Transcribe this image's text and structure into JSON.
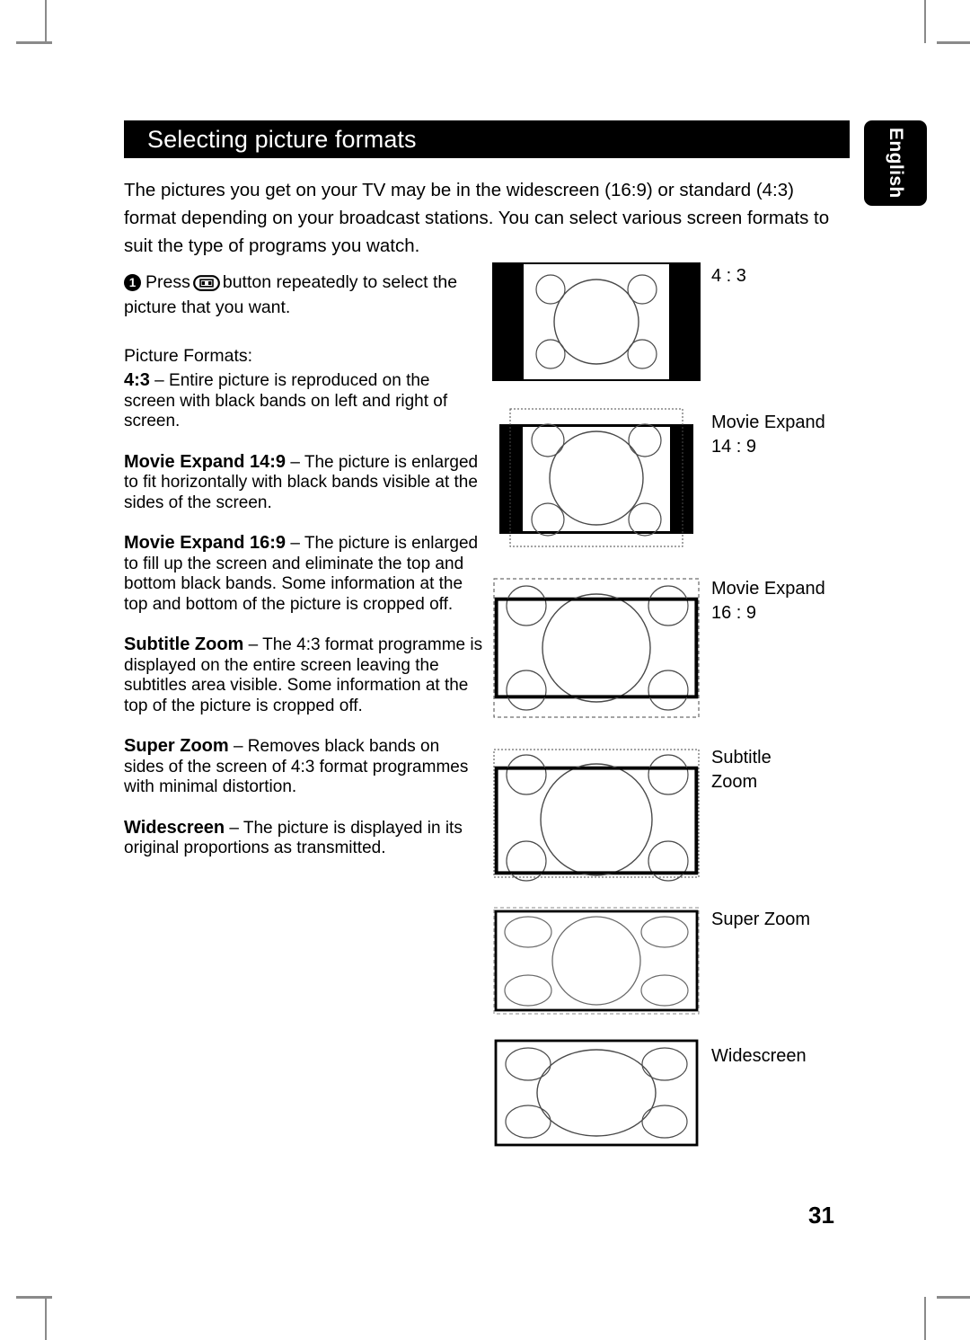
{
  "document": {
    "page_number": "31",
    "language_tab": "English",
    "title": "Selecting picture formats",
    "intro": "The pictures you get on your TV may be in the widescreen (16:9) or standard (4:3) format depending on your broadcast stations. You can select various screen formats to suit the type of programs you watch."
  },
  "step": {
    "number": "1",
    "text_before_icon": "Press",
    "icon_name": "picture-format-button-icon",
    "text_after_icon": "button repeatedly to select the picture that you want."
  },
  "formats_heading": "Picture Formats:",
  "formats": [
    {
      "name": "4:3",
      "dash": " – ",
      "description": "Entire picture is reproduced on the screen with black bands on left and right of screen.",
      "diagram_label": "4 : 3"
    },
    {
      "name": "Movie Expand 14:9",
      "dash": " – ",
      "description": "The picture is enlarged to fit horizontally with black bands visible at the sides of the screen.",
      "diagram_label": "Movie Expand\n14 : 9"
    },
    {
      "name": "Movie Expand 16:9",
      "dash": " – ",
      "description": "The picture is enlarged to fill up the screen and eliminate the top and bottom black bands.  Some information at the top and bottom of the picture is cropped off.",
      "diagram_label": "Movie Expand\n16 : 9"
    },
    {
      "name": "Subtitle Zoom",
      "dash": " – ",
      "description": "The 4:3 format programme is displayed on the entire screen leaving the subtitles area visible.  Some information at the top of the picture is cropped off.",
      "diagram_label": "Subtitle\nZoom"
    },
    {
      "name": "Super Zoom",
      "dash": " – ",
      "description": "Removes black bands on sides of the screen of 4:3 format programmes with minimal distortion.",
      "diagram_label": "Super Zoom"
    },
    {
      "name": "Widescreen",
      "dash": " – ",
      "description": "The picture is displayed in its original proportions as transmitted.",
      "diagram_label": "Widescreen"
    }
  ],
  "colors": {
    "ink": "#000000",
    "paper": "#ffffff",
    "crop_mark": "#8a8a8a",
    "diagram_stroke": "#4a4a4a"
  }
}
